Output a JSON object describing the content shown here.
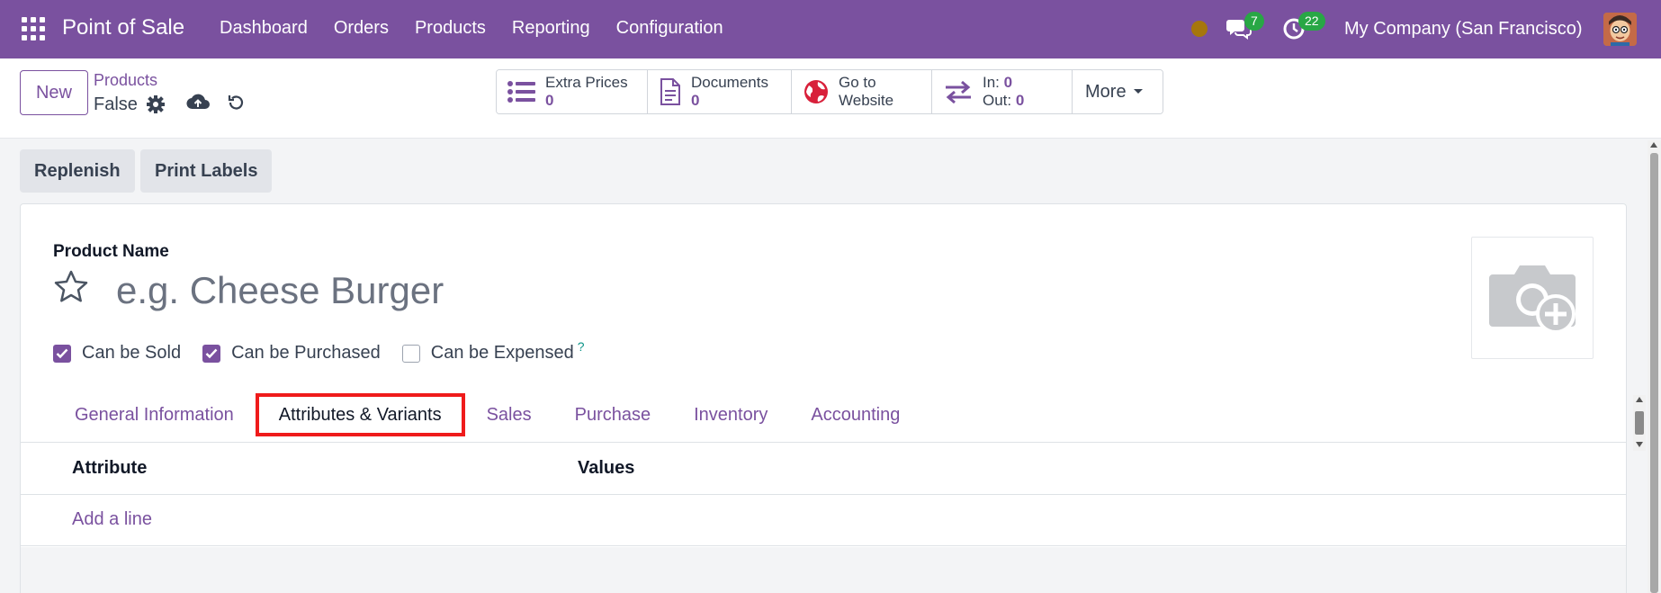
{
  "navbar": {
    "app_name": "Point of Sale",
    "menu": [
      "Dashboard",
      "Orders",
      "Products",
      "Reporting",
      "Configuration"
    ],
    "chat_count": "7",
    "activity_count": "22",
    "company": "My Company (San Francisco)"
  },
  "control_panel": {
    "new_label": "New",
    "breadcrumb": "Products",
    "record_name": "False",
    "stat_buttons": [
      {
        "label": "Extra Prices",
        "value": "0"
      },
      {
        "label": "Documents",
        "value": "0"
      },
      {
        "label_line1": "Go to",
        "label_line2": "Website"
      },
      {
        "in_label": "In:",
        "in_value": "0",
        "out_label": "Out:",
        "out_value": "0"
      }
    ],
    "more_label": "More"
  },
  "actions": {
    "replenish": "Replenish",
    "print_labels": "Print Labels"
  },
  "form": {
    "product_name_label": "Product Name",
    "product_name_placeholder": "e.g. Cheese Burger",
    "checkboxes": [
      {
        "label": "Can be Sold",
        "checked": true
      },
      {
        "label": "Can be Purchased",
        "checked": true
      },
      {
        "label": "Can be Expensed",
        "checked": false,
        "help": "?"
      }
    ],
    "tabs": [
      "General Information",
      "Attributes & Variants",
      "Sales",
      "Purchase",
      "Inventory",
      "Accounting"
    ],
    "active_tab": "Attributes & Variants",
    "table": {
      "columns": [
        "Attribute",
        "Values"
      ],
      "add_line": "Add a line"
    }
  },
  "colors": {
    "brand": "#7a519f",
    "badge": "#28a745",
    "highlight": "#ef1b1b"
  }
}
